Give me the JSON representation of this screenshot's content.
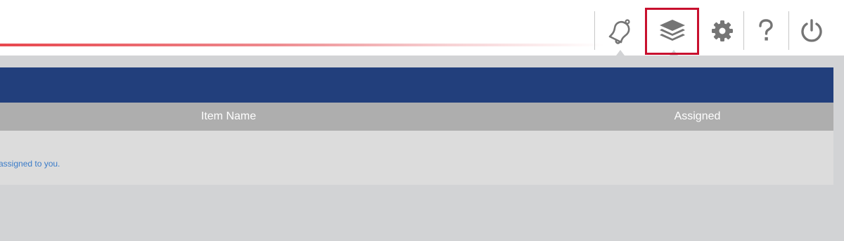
{
  "toolbar": {
    "icons": [
      {
        "name": "notifications",
        "icon": "bell-icon"
      },
      {
        "name": "layers",
        "icon": "layers-icon",
        "highlighted": true
      },
      {
        "name": "settings",
        "icon": "gear-icon"
      },
      {
        "name": "help",
        "icon": "question-icon"
      },
      {
        "name": "logout",
        "icon": "power-icon"
      }
    ],
    "icon_color": "#757575",
    "highlight_color": "#c8102e"
  },
  "panel": {
    "header_color": "#223f7c",
    "columns": [
      "Item Name",
      "Assigned"
    ],
    "empty_message": "assigned to you."
  }
}
